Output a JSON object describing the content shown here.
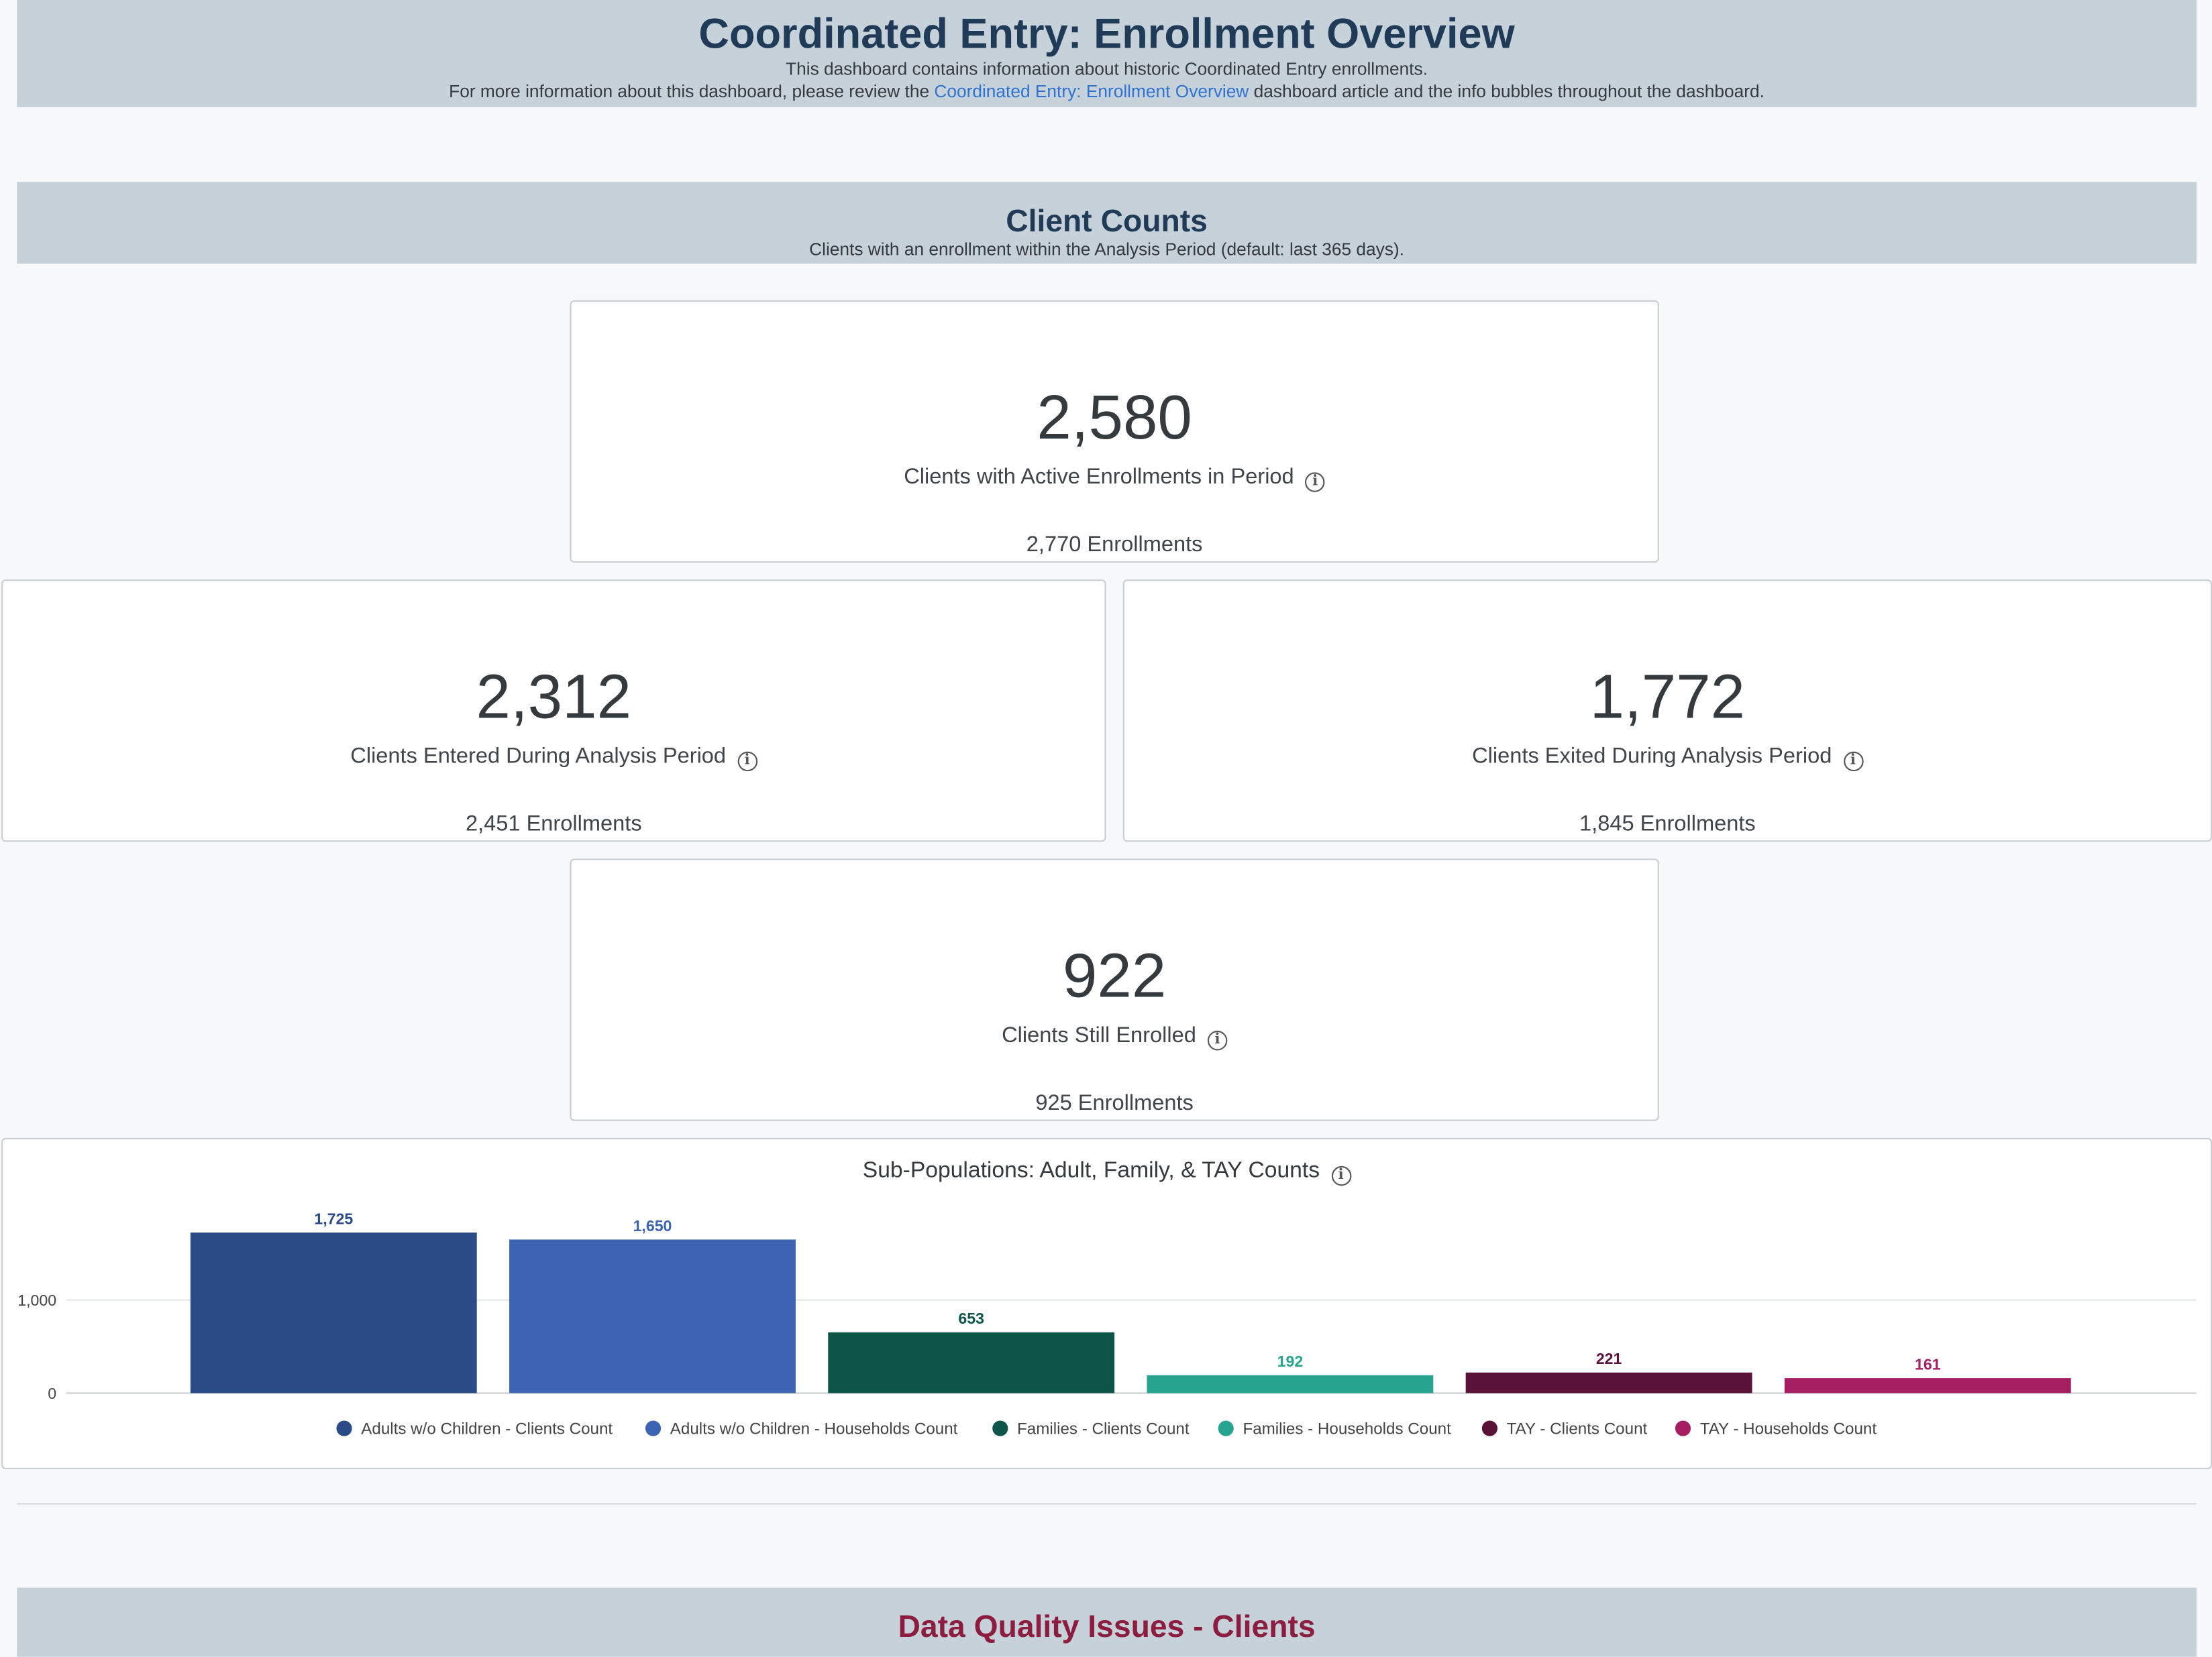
{
  "header": {
    "title": "Coordinated Entry: Enrollment Overview",
    "line1": "This dashboard contains information about historic Coordinated Entry enrollments.",
    "line2_prefix": "For more information about this dashboard, please review the ",
    "line2_link": "Coordinated Entry: Enrollment Overview",
    "line2_suffix": " dashboard article and the info bubbles throughout the dashboard."
  },
  "client_counts": {
    "title": "Client Counts",
    "subtitle": "Clients with an enrollment within the Analysis Period (default: last 365 days)."
  },
  "cards": {
    "active": {
      "value": "2,580",
      "label": "Clients with Active Enrollments in Period",
      "footer": "2,770 Enrollments"
    },
    "entered": {
      "value": "2,312",
      "label": "Clients Entered During Analysis Period",
      "footer": "2,451 Enrollments"
    },
    "exited": {
      "value": "1,772",
      "label": "Clients Exited During Analysis Period",
      "footer": "1,845 Enrollments"
    },
    "still": {
      "value": "922",
      "label": "Clients Still Enrolled",
      "footer": "925 Enrollments"
    }
  },
  "info_glyph": "i",
  "chart_data": {
    "type": "bar",
    "title": "Sub-Populations: Adult, Family, & TAY Counts",
    "categories": [
      "Adults w/o Children - Clients Count",
      "Adults w/o Children - Households Count",
      "Families - Clients Count",
      "Families - Households Count",
      "TAY - Clients Count",
      "TAY - Households Count"
    ],
    "values": [
      1725,
      1650,
      653,
      192,
      221,
      161
    ],
    "value_labels": [
      "1,725",
      "1,650",
      "653",
      "192",
      "221",
      "161"
    ],
    "colors": [
      "#2b4b86",
      "#3d64b3",
      "#0e5549",
      "#26a48f",
      "#5b1238",
      "#a61e62"
    ],
    "yticks": [
      0,
      1000
    ],
    "ytick_labels": [
      "0",
      "1,000"
    ],
    "ylim": [
      0,
      1800
    ],
    "grid": true,
    "legend": "bottom"
  },
  "data_quality": {
    "title": "Data Quality Issues - Clients"
  }
}
